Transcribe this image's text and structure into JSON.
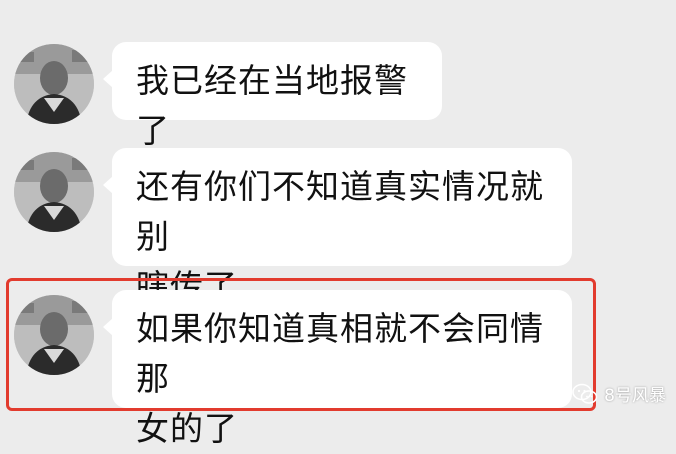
{
  "chat": {
    "messages": [
      {
        "text_lines": [
          "我已经在当地报警了"
        ],
        "highlighted": false
      },
      {
        "text_lines": [
          "还有你们不知道真实情况就别",
          "瞎传了"
        ],
        "highlighted": false
      },
      {
        "text_lines": [
          "如果你知道真相就不会同情那",
          "女的了"
        ],
        "highlighted": true
      }
    ]
  },
  "watermark": {
    "text": "8号风暴",
    "icon": "wechat-logo-icon"
  },
  "colors": {
    "background": "#ececec",
    "bubble": "#ffffff",
    "highlight_border": "#e23b2e",
    "text": "#111111"
  }
}
